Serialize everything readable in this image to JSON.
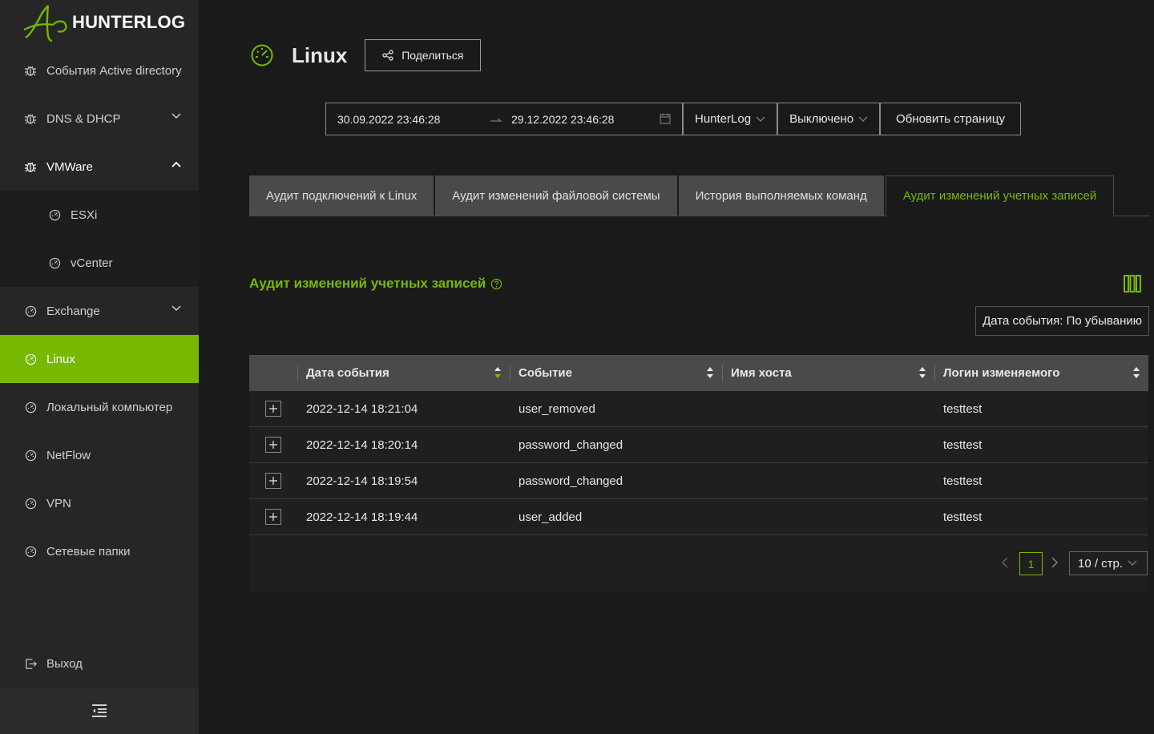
{
  "app": {
    "name": "HUNTERLOG",
    "brand_color": "#76b900"
  },
  "sidebar": {
    "items": [
      {
        "label": "События Active directory",
        "icon": "bug-icon"
      },
      {
        "label": "DNS & DHCP",
        "icon": "bug-icon",
        "expand": "chevron-down"
      },
      {
        "label": "VMWare",
        "icon": "bug-icon",
        "expand": "chevron-up"
      },
      {
        "label": "ESXi",
        "icon": "dashboard-icon"
      },
      {
        "label": "vCenter",
        "icon": "dashboard-icon"
      },
      {
        "label": "Exchange",
        "icon": "dashboard-icon",
        "expand": "chevron-down"
      },
      {
        "label": "Linux",
        "icon": "dashboard-icon",
        "active": true
      },
      {
        "label": "Локальный компьютер",
        "icon": "dashboard-icon"
      },
      {
        "label": "NetFlow",
        "icon": "dashboard-icon"
      },
      {
        "label": "VPN",
        "icon": "dashboard-icon"
      },
      {
        "label": "Сетевые папки",
        "icon": "dashboard-icon"
      }
    ],
    "logout_label": "Выход"
  },
  "page": {
    "title": "Linux",
    "share_label": "Поделиться"
  },
  "filters": {
    "date_from": "30.09.2022 23:46:28",
    "date_to": "29.12.2022 23:46:28",
    "source": "HunterLog",
    "auto_refresh": "Выключено",
    "refresh_label": "Обновить страницу"
  },
  "tabs": [
    {
      "label": "Аудит подключений к Linux"
    },
    {
      "label": "Аудит изменений файловой системы"
    },
    {
      "label": "История выполняемых команд"
    },
    {
      "label": "Аудит изменений учетных записей",
      "active": true
    }
  ],
  "section": {
    "title": "Аудит изменений учетных записей",
    "sort_label": "Дата события: По убыванию"
  },
  "table": {
    "columns": [
      "Дата события",
      "Событие",
      "Имя хоста",
      "Логин изменяемого"
    ],
    "rows": [
      [
        "2022-12-14 18:21:04",
        "user_removed",
        "",
        "testtest"
      ],
      [
        "2022-12-14 18:20:14",
        "password_changed",
        "",
        "testtest"
      ],
      [
        "2022-12-14 18:19:54",
        "password_changed",
        "",
        "testtest"
      ],
      [
        "2022-12-14 18:19:44",
        "user_added",
        "",
        "testtest"
      ]
    ]
  },
  "pagination": {
    "current_page": "1",
    "page_size": "10 / стр."
  }
}
